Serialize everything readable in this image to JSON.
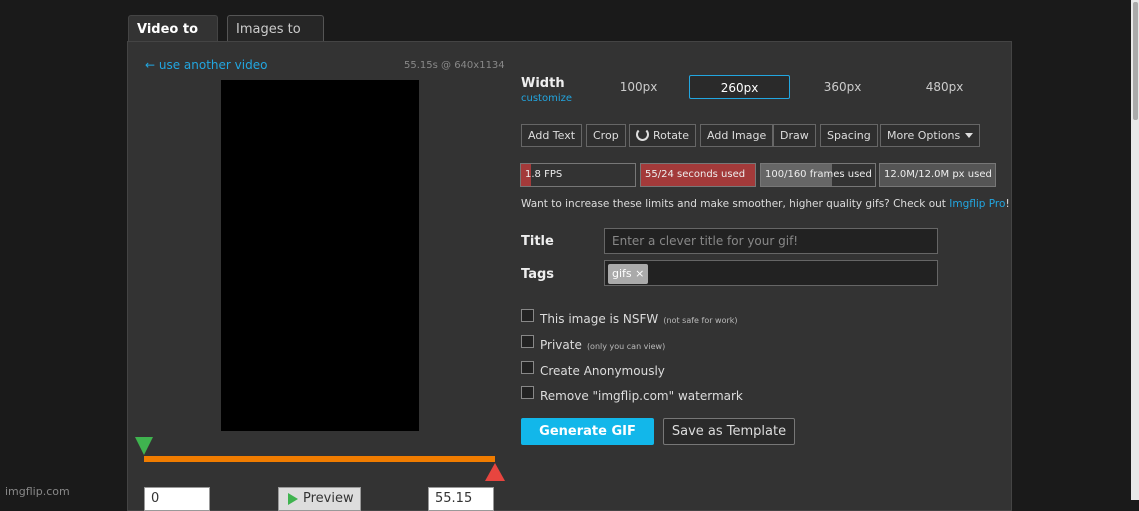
{
  "tabs": {
    "video_to_gif": "Video to GIF",
    "images_to_gif": "Images to GIF"
  },
  "video": {
    "use_another": "← use another video",
    "info": "55.15s @ 640x1134",
    "start_value": "0",
    "end_value": "55.15",
    "preview_label": "Preview"
  },
  "width": {
    "label": "Width",
    "customize": "customize",
    "options": [
      "100px",
      "260px",
      "360px",
      "480px"
    ],
    "selected": "260px"
  },
  "tools": {
    "add_text": "Add Text",
    "crop": "Crop",
    "rotate": "Rotate",
    "add_image": "Add Image",
    "draw": "Draw",
    "spacing": "Spacing",
    "more_options": "More Options"
  },
  "limits": [
    {
      "label": "1.8 FPS",
      "fraction": 0.09,
      "color": "#a33a3a"
    },
    {
      "label": "55/24 seconds used",
      "fraction": 1.0,
      "color": "#a33a3a"
    },
    {
      "label": "100/160 frames used",
      "fraction": 0.625,
      "color": "#666666"
    },
    {
      "label": "12.0M/12.0M px used",
      "fraction": 1.0,
      "color": "#555555"
    }
  ],
  "upsell": {
    "text": "Want to increase these limits and make smoother, higher quality gifs? Check out ",
    "link": "Imgflip Pro",
    "suffix": "!"
  },
  "form": {
    "title_label": "Title",
    "title_placeholder": "Enter a clever title for your gif!",
    "tags_label": "Tags",
    "tags": [
      "gifs"
    ],
    "tag_remove": "×"
  },
  "checkboxes": [
    {
      "label": "This image is NSFW",
      "note": "(not safe for work)"
    },
    {
      "label": "Private",
      "note": "(only you can view)"
    },
    {
      "label": "Create Anonymously",
      "note": ""
    },
    {
      "label": "Remove \"imgflip.com\" watermark",
      "note": ""
    }
  ],
  "buttons": {
    "generate": "Generate GIF",
    "save_template": "Save as Template"
  },
  "watermark": "imgflip.com"
}
